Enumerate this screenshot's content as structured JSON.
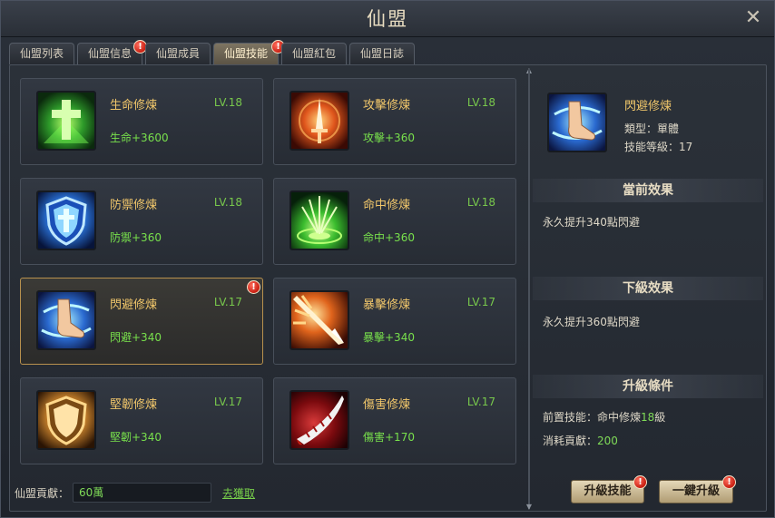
{
  "window": {
    "title": "仙盟",
    "close_label": "✕"
  },
  "tabs": [
    {
      "label": "仙盟列表",
      "active": false,
      "alert": false
    },
    {
      "label": "仙盟信息",
      "active": false,
      "alert": true
    },
    {
      "label": "仙盟成員",
      "active": false,
      "alert": false
    },
    {
      "label": "仙盟技能",
      "active": true,
      "alert": true
    },
    {
      "label": "仙盟紅包",
      "active": false,
      "alert": false
    },
    {
      "label": "仙盟日誌",
      "active": false,
      "alert": false
    }
  ],
  "skills": [
    {
      "name": "生命修煉",
      "level": "LV.18",
      "effect": "生命+3600",
      "icon": "health-cross-icon"
    },
    {
      "name": "攻擊修煉",
      "level": "LV.18",
      "effect": "攻擊+360",
      "icon": "flaming-sword-icon"
    },
    {
      "name": "防禦修煉",
      "level": "LV.18",
      "effect": "防禦+360",
      "icon": "blue-shield-icon"
    },
    {
      "name": "命中修煉",
      "level": "LV.18",
      "effect": "命中+360",
      "icon": "target-arrows-icon"
    },
    {
      "name": "閃避修煉",
      "level": "LV.17",
      "effect": "閃避+340",
      "icon": "swift-foot-icon",
      "selected": true,
      "alert": true
    },
    {
      "name": "暴擊修煉",
      "level": "LV.17",
      "effect": "暴擊+340",
      "icon": "critical-strike-icon"
    },
    {
      "name": "堅韌修煉",
      "level": "LV.17",
      "effect": "堅韌+340",
      "icon": "golden-shield-icon"
    },
    {
      "name": "傷害修煉",
      "level": "LV.17",
      "effect": "傷害+170",
      "icon": "bloody-blade-icon"
    }
  ],
  "contribution": {
    "label": "仙盟貢獻：",
    "value": "60萬",
    "link": "去獲取"
  },
  "detail": {
    "name": "閃避修煉",
    "type": "類型：單體",
    "level": "技能等級：17",
    "current_header": "當前效果",
    "current_text": "永久提升340點閃避",
    "next_header": "下級效果",
    "next_text": "永久提升360點閃避",
    "cond_header": "升級條件",
    "cond_prereq_prefix": "前置技能：命中修煉",
    "cond_prereq_level": "18",
    "cond_prereq_suffix": "級",
    "cond_cost_label": "消耗貢獻：",
    "cond_cost_value": "200"
  },
  "buttons": {
    "upgrade": "升級技能",
    "one_click": "一鍵升級"
  },
  "colors": {
    "accent": "#f0c66a",
    "level_green": "#78c84c",
    "alert_red": "#c81f12"
  }
}
